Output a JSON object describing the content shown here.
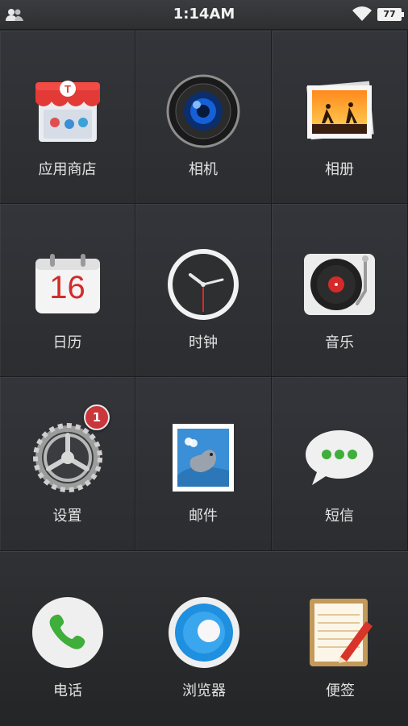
{
  "status_bar": {
    "time": "1:14AM",
    "battery": "77"
  },
  "apps": [
    {
      "label": "应用商店",
      "icon": "app-store-icon"
    },
    {
      "label": "相机",
      "icon": "camera-icon"
    },
    {
      "label": "相册",
      "icon": "gallery-icon"
    },
    {
      "label": "日历",
      "icon": "calendar-icon",
      "day": "16"
    },
    {
      "label": "时钟",
      "icon": "clock-icon"
    },
    {
      "label": "音乐",
      "icon": "music-icon"
    },
    {
      "label": "设置",
      "icon": "settings-icon",
      "badge": "1"
    },
    {
      "label": "邮件",
      "icon": "mail-icon"
    },
    {
      "label": "短信",
      "icon": "messages-icon"
    }
  ],
  "dock": [
    {
      "label": "电话",
      "icon": "phone-icon"
    },
    {
      "label": "浏览器",
      "icon": "browser-icon"
    },
    {
      "label": "便签",
      "icon": "notes-icon"
    }
  ],
  "colors": {
    "accent_red": "#c9363b",
    "phone_green": "#3fae3a",
    "browser_blue": "#1f8fe0"
  }
}
